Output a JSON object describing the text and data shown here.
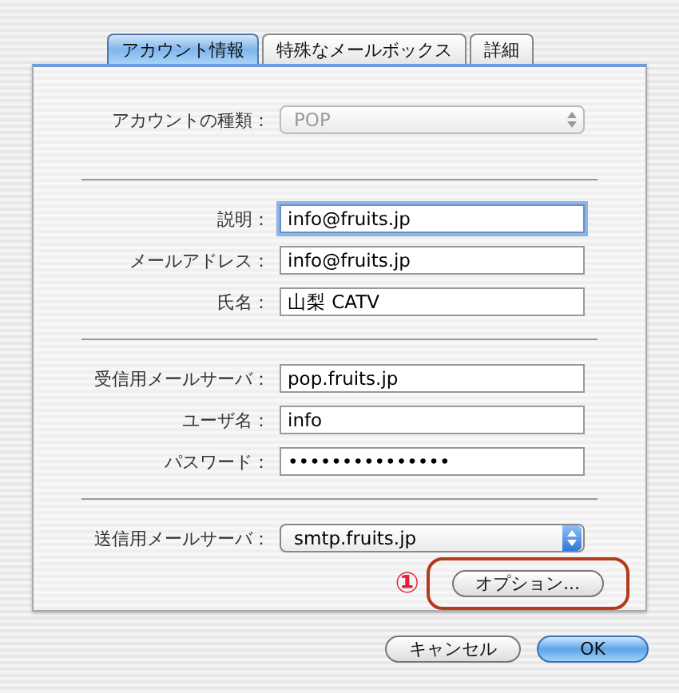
{
  "tabs": [
    {
      "label": "アカウント情報",
      "selected": true
    },
    {
      "label": "特殊なメールボックス",
      "selected": false
    },
    {
      "label": "詳細",
      "selected": false
    }
  ],
  "sections": [
    {
      "rows": [
        {
          "kind": "popup",
          "label": "アカウントの種類：",
          "value": "POP",
          "disabled": true
        }
      ]
    },
    {
      "rows": [
        {
          "kind": "text",
          "label": "説明：",
          "value": "info@fruits.jp",
          "focused": true
        },
        {
          "kind": "text",
          "label": "メールアドレス：",
          "value": "info@fruits.jp",
          "focused": false
        },
        {
          "kind": "text",
          "label": "氏名：",
          "value": "山梨 CATV",
          "focused": false
        }
      ]
    },
    {
      "rows": [
        {
          "kind": "text",
          "label": "受信用メールサーバ：",
          "value": "pop.fruits.jp",
          "focused": false
        },
        {
          "kind": "text",
          "label": "ユーザ名：",
          "value": "info",
          "focused": false
        },
        {
          "kind": "password",
          "label": "パスワード：",
          "value": "•••••••••••••••",
          "focused": false
        }
      ]
    },
    {
      "rows": [
        {
          "kind": "popup",
          "label": "送信用メールサーバ：",
          "value": "smtp.fruits.jp",
          "disabled": false
        }
      ]
    }
  ],
  "options_button": {
    "label": "オプション...",
    "marker": "①"
  },
  "buttons": [
    {
      "label": "キャンセル",
      "default": false
    },
    {
      "label": "OK",
      "default": true
    }
  ]
}
